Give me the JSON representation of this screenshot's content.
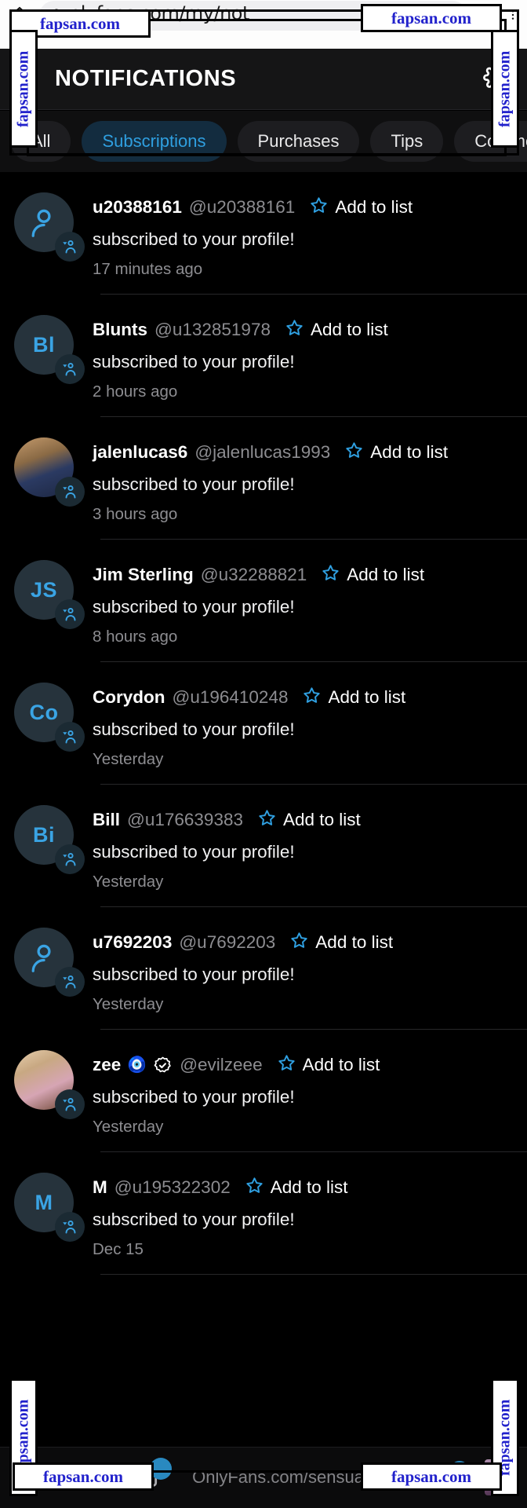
{
  "browser": {
    "url": "nlyfans.com/my/not",
    "url_full_visible": "...fans.com/my/not...",
    "lock_icon": "lock-icon",
    "home_icon": "home-icon",
    "tabs_icon": "tabs-icon",
    "menu_icon": "more-vertical-icon"
  },
  "header": {
    "back_icon": "back-arrow-icon",
    "title": "NOTIFICATIONS",
    "settings_icon": "gear-icon"
  },
  "tabs": [
    {
      "label": "All",
      "active": false
    },
    {
      "label": "Subscriptions",
      "active": true
    },
    {
      "label": "Purchases",
      "active": false
    },
    {
      "label": "Tips",
      "active": false
    },
    {
      "label": "Comments",
      "active": false
    }
  ],
  "list": {
    "add_to_list_label": "Add to list",
    "star_icon": "star-outline-icon",
    "subscribe_badge_icon": "new-subscriber-icon",
    "items": [
      {
        "username": "u20388161",
        "handle": "@u20388161",
        "message": "subscribed to your profile!",
        "time": "17 minutes ago",
        "avatar_type": "generic",
        "avatar_initials": "",
        "emoji": "",
        "verified": false
      },
      {
        "username": "Blunts",
        "handle": "@u132851978",
        "message": "subscribed to your profile!",
        "time": "2 hours ago",
        "avatar_type": "initials",
        "avatar_initials": "Bl",
        "emoji": "",
        "verified": false
      },
      {
        "username": "jalenlucas6",
        "handle": "@jalenlucas1993",
        "message": "subscribed to your profile!",
        "time": "3 hours ago",
        "avatar_type": "photo-a",
        "avatar_initials": "",
        "emoji": "",
        "verified": false
      },
      {
        "username": "Jim Sterling",
        "handle": "@u32288821",
        "message": "subscribed to your profile!",
        "time": "8 hours ago",
        "avatar_type": "initials",
        "avatar_initials": "JS",
        "emoji": "",
        "verified": false
      },
      {
        "username": "Corydon",
        "handle": "@u196410248",
        "message": "subscribed to your profile!",
        "time": "Yesterday",
        "avatar_type": "initials",
        "avatar_initials": "Co",
        "emoji": "",
        "verified": false
      },
      {
        "username": "Bill",
        "handle": "@u176639383",
        "message": "subscribed to your profile!",
        "time": "Yesterday",
        "avatar_type": "initials",
        "avatar_initials": "Bi",
        "emoji": "",
        "verified": false
      },
      {
        "username": "u7692203",
        "handle": "@u7692203",
        "message": "subscribed to your profile!",
        "time": "Yesterday",
        "avatar_type": "generic",
        "avatar_initials": "",
        "emoji": "",
        "verified": false
      },
      {
        "username": "zee",
        "handle": "@evilzeee",
        "message": "subscribed to your profile!",
        "time": "Yesterday",
        "avatar_type": "photo-b",
        "avatar_initials": "",
        "emoji": "🧿",
        "verified": true
      },
      {
        "username": "M",
        "handle": "@u195322302",
        "message": "subscribed to your profile!",
        "time": "Dec 15",
        "avatar_type": "initials",
        "avatar_initials": "M",
        "emoji": "",
        "verified": false
      }
    ]
  },
  "bottom_bar": {
    "add_icon": "add-post-icon",
    "caption": "OnlyFans.com/sensualnash"
  },
  "watermarks": {
    "text": "fapsan.com",
    "color": "#2222cc"
  }
}
